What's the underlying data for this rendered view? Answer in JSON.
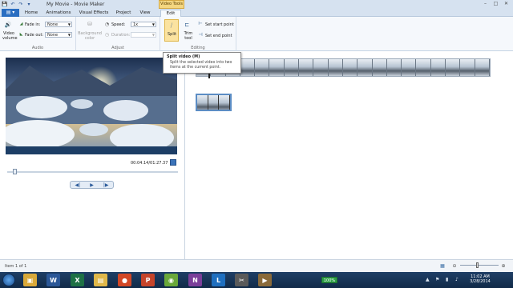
{
  "window": {
    "title": "My Movie - Movie Maker",
    "context_group": "Video Tools",
    "min": "–",
    "max": "□",
    "close": "✕"
  },
  "qat": {
    "save": "💾",
    "undo": "↶",
    "redo": "↷",
    "more": "▾"
  },
  "tabs": {
    "file": "▤ ▾",
    "items": [
      "Home",
      "Animations",
      "Visual Effects",
      "Project",
      "View",
      "Edit"
    ],
    "active": "Edit"
  },
  "ribbon": {
    "audio": {
      "label": "Audio",
      "video_volume": "Video volume",
      "fade_in": "Fade in:",
      "fade_in_value": "None",
      "fade_out": "Fade out:",
      "fade_out_value": "None"
    },
    "adjust": {
      "label": "Adjust",
      "background_color": "Background color",
      "speed": "Speed:",
      "speed_value": "1x",
      "duration": "Duration:"
    },
    "editing": {
      "label": "Editing",
      "split": "Split",
      "trim_tool": "Trim tool",
      "set_start": "Set start point",
      "set_end": "Set end point"
    }
  },
  "tooltip": {
    "title": "Split video (M)",
    "body": "Split the selected video into two items at the current point."
  },
  "player": {
    "timecode": "00:04.14/01:27.37",
    "prev": "◀|",
    "play": "▶",
    "next": "|▶"
  },
  "status": {
    "text": "Item 1 of 1"
  },
  "tray": {
    "battery": "100%",
    "time": "11:02 AM",
    "date": "3/28/2014"
  },
  "taskbar_apps": [
    {
      "icon": "folder-icon",
      "glyph": "▣",
      "color": "#d9a93a"
    },
    {
      "icon": "word-icon",
      "glyph": "W",
      "color": "#2b5797"
    },
    {
      "icon": "excel-icon",
      "glyph": "X",
      "color": "#1e7145"
    },
    {
      "icon": "explorer-icon",
      "glyph": "▤",
      "color": "#e0b84a"
    },
    {
      "icon": "chrome-icon",
      "glyph": "●",
      "color": "#d24726"
    },
    {
      "icon": "powerpoint-icon",
      "glyph": "P",
      "color": "#c6442a"
    },
    {
      "icon": "media-icon",
      "glyph": "◉",
      "color": "#6aa83a"
    },
    {
      "icon": "onenote-icon",
      "glyph": "N",
      "color": "#7b3f9a"
    },
    {
      "icon": "lync-icon",
      "glyph": "L",
      "color": "#1f6fbf"
    },
    {
      "icon": "snipping-icon",
      "glyph": "✂",
      "color": "#5a5a5a"
    },
    {
      "icon": "moviemaker-icon",
      "glyph": "▶",
      "color": "#8a6a3a"
    }
  ]
}
